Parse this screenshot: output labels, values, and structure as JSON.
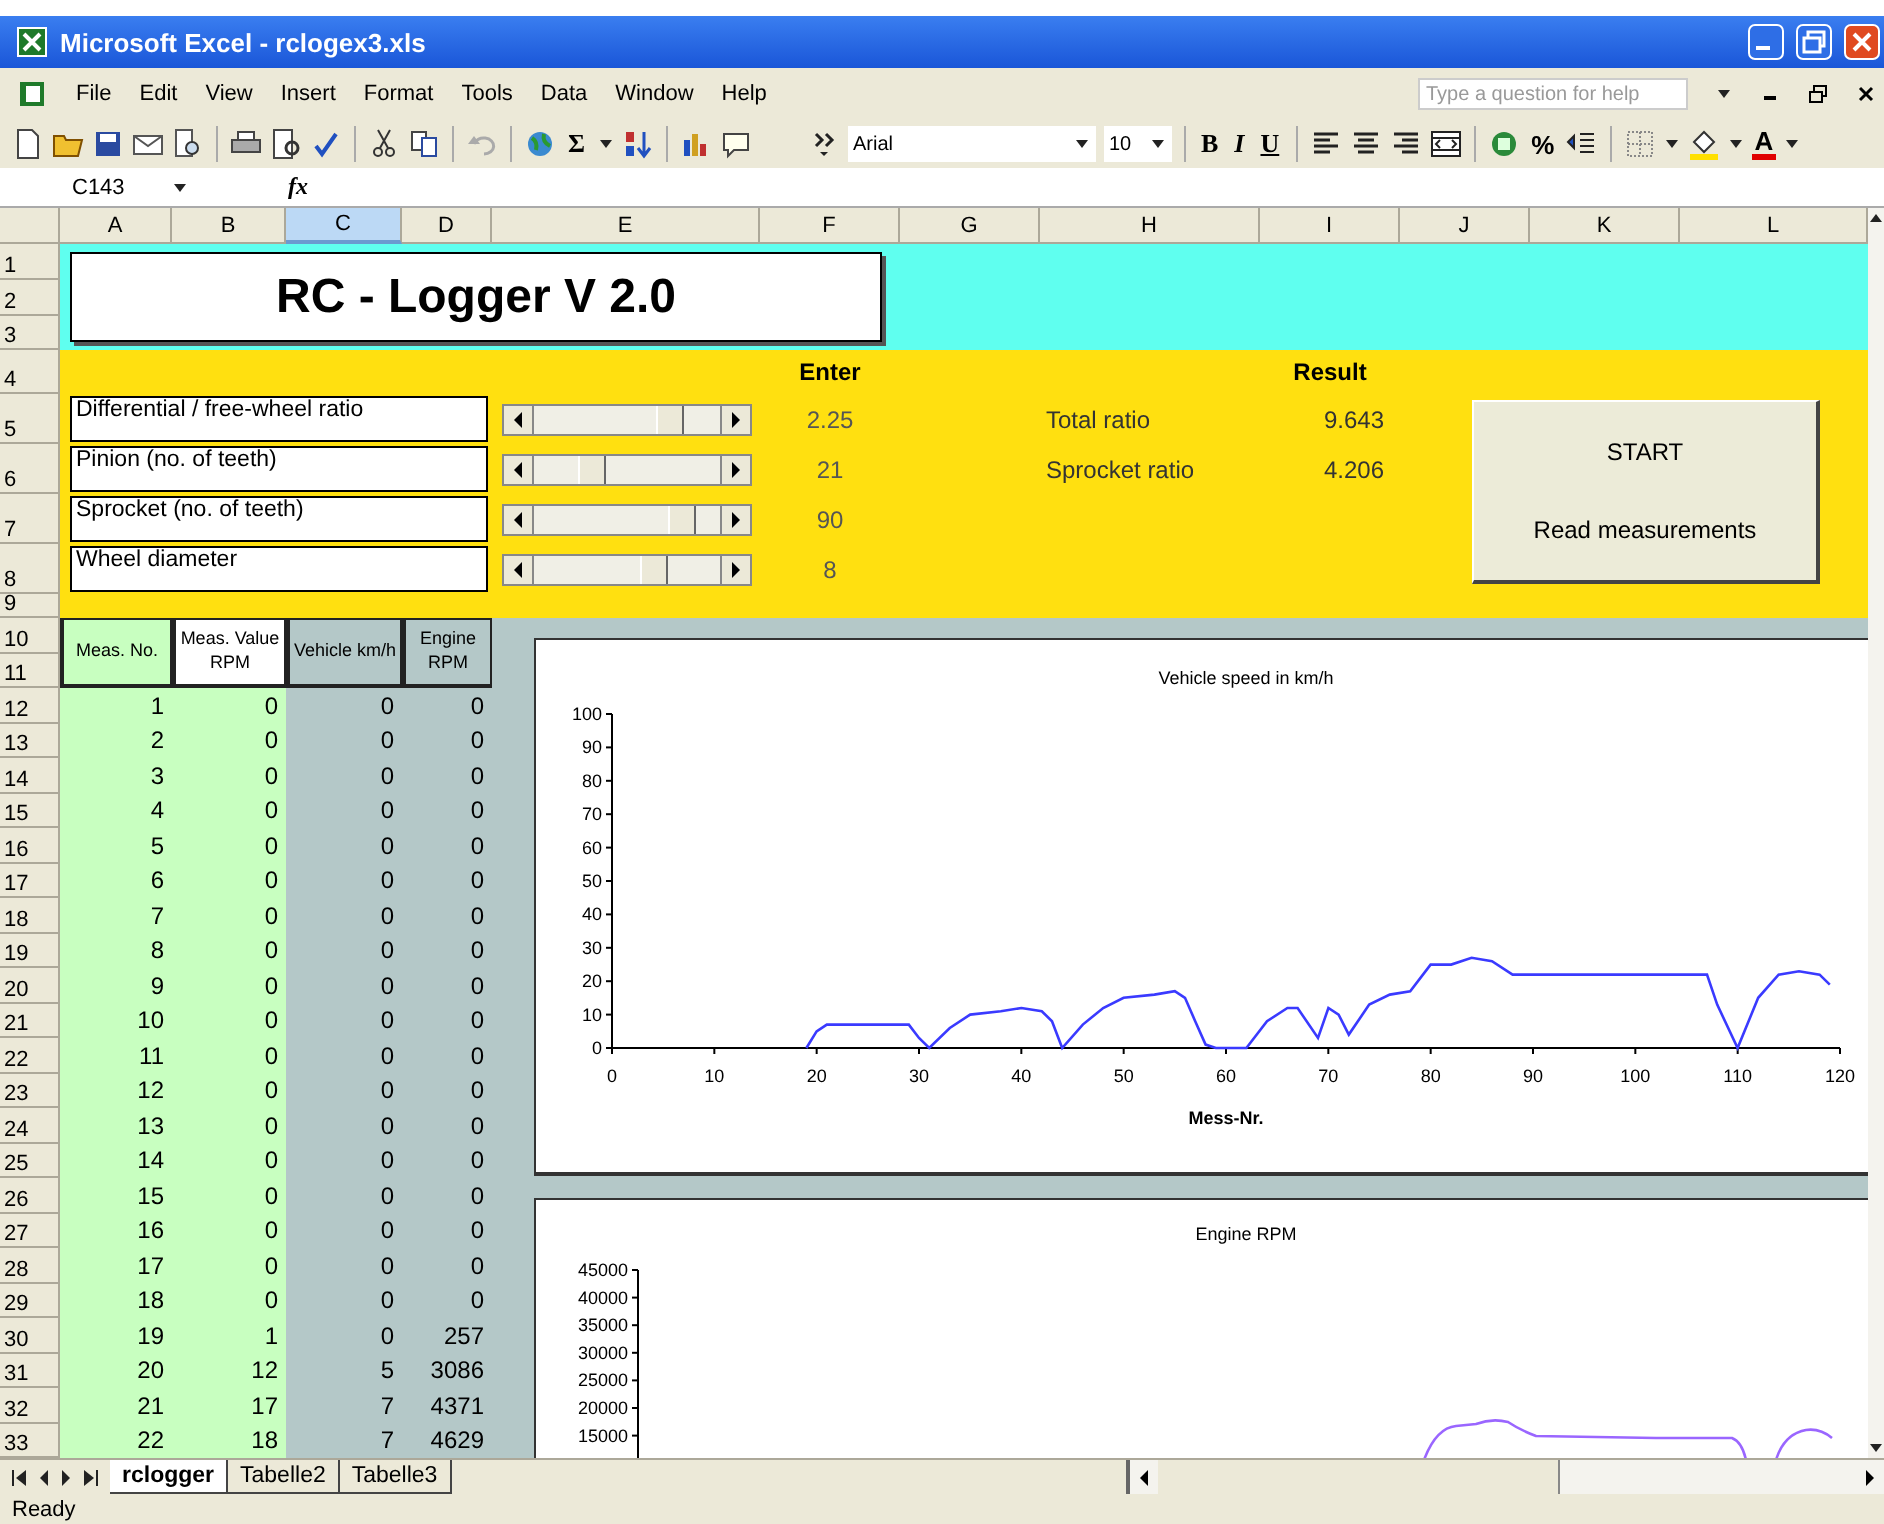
{
  "window": {
    "title": "Microsoft Excel - rclogex3.xls"
  },
  "menu": [
    "File",
    "Edit",
    "View",
    "Insert",
    "Format",
    "Tools",
    "Data",
    "Window",
    "Help"
  ],
  "help_box": {
    "placeholder": "Type a question for help"
  },
  "toolbar": {
    "sum": "Σ",
    "font": "Arial",
    "size": "10",
    "bold": "B",
    "italic": "I",
    "underline": "U",
    "percent": "%",
    "font_color": "A"
  },
  "formula_bar": {
    "name_box": "C143",
    "fx": "fx"
  },
  "columns": [
    {
      "label": "A",
      "selected": false
    },
    {
      "label": "B",
      "selected": false
    },
    {
      "label": "C",
      "selected": true
    },
    {
      "label": "D",
      "selected": false
    },
    {
      "label": "E",
      "selected": false
    },
    {
      "label": "F",
      "selected": false
    },
    {
      "label": "G",
      "selected": false
    },
    {
      "label": "H",
      "selected": false
    },
    {
      "label": "I",
      "selected": false
    },
    {
      "label": "J",
      "selected": false
    },
    {
      "label": "K",
      "selected": false
    },
    {
      "label": "L",
      "selected": false
    }
  ],
  "row_headers": [
    "1",
    "2",
    "3",
    "4",
    "5",
    "6",
    "7",
    "8",
    "9",
    "10",
    "11",
    "12",
    "13",
    "14",
    "15",
    "16",
    "17",
    "18",
    "19",
    "20",
    "21",
    "22",
    "23",
    "24",
    "25",
    "26",
    "27",
    "28",
    "29",
    "30",
    "31",
    "32",
    "33"
  ],
  "banner": {
    "title": "RC - Logger V 2.0"
  },
  "inputs": {
    "enter_header": "Enter",
    "result_header": "Result",
    "params": [
      {
        "label": "Differential / free-wheel ratio",
        "level": 0.72,
        "value": "2.25"
      },
      {
        "label": "Pinion (no. of teeth)",
        "level": 0.3,
        "value": "21"
      },
      {
        "label": "Sprocket (no. of teeth)",
        "level": 0.78,
        "value": "90"
      },
      {
        "label": "Wheel diameter",
        "level": 0.63,
        "value": "8"
      }
    ],
    "results": [
      {
        "label": "Total ratio",
        "value": "9.643"
      },
      {
        "label": "Sprocket ratio",
        "value": "4.206"
      }
    ],
    "button": {
      "lines": [
        "START",
        "Read measurements"
      ]
    }
  },
  "table": {
    "columns": [
      "Meas. No.",
      "Meas. Value RPM",
      "Vehicle km/h",
      "Engine RPM"
    ],
    "rows": [
      [
        "1",
        "0",
        "0",
        "0"
      ],
      [
        "2",
        "0",
        "0",
        "0"
      ],
      [
        "3",
        "0",
        "0",
        "0"
      ],
      [
        "4",
        "0",
        "0",
        "0"
      ],
      [
        "5",
        "0",
        "0",
        "0"
      ],
      [
        "6",
        "0",
        "0",
        "0"
      ],
      [
        "7",
        "0",
        "0",
        "0"
      ],
      [
        "8",
        "0",
        "0",
        "0"
      ],
      [
        "9",
        "0",
        "0",
        "0"
      ],
      [
        "10",
        "0",
        "0",
        "0"
      ],
      [
        "11",
        "0",
        "0",
        "0"
      ],
      [
        "12",
        "0",
        "0",
        "0"
      ],
      [
        "13",
        "0",
        "0",
        "0"
      ],
      [
        "14",
        "0",
        "0",
        "0"
      ],
      [
        "15",
        "0",
        "0",
        "0"
      ],
      [
        "16",
        "0",
        "0",
        "0"
      ],
      [
        "17",
        "0",
        "0",
        "0"
      ],
      [
        "18",
        "0",
        "0",
        "0"
      ],
      [
        "19",
        "1",
        "0",
        "257"
      ],
      [
        "20",
        "12",
        "5",
        "3086"
      ],
      [
        "21",
        "17",
        "7",
        "4371"
      ],
      [
        "22",
        "18",
        "7",
        "4629"
      ]
    ]
  },
  "charts": [
    {
      "chart_data": {
        "type": "line",
        "title": "Vehicle speed in km/h",
        "xlabel": "Mess-Nr.",
        "xlim": [
          0,
          120
        ],
        "ylim": [
          0,
          100
        ],
        "xticks": [
          0,
          10,
          20,
          30,
          40,
          50,
          60,
          70,
          80,
          90,
          100,
          110,
          120
        ],
        "yticks": [
          0,
          10,
          20,
          30,
          40,
          50,
          60,
          70,
          80,
          90,
          100
        ],
        "x": [
          19,
          20,
          21,
          25,
          28,
          29,
          30,
          31,
          33,
          35,
          38,
          40,
          42,
          43,
          44,
          46,
          48,
          50,
          53,
          55,
          56,
          57,
          58,
          59,
          62,
          64,
          66,
          67,
          69,
          70,
          71,
          72,
          74,
          76,
          78,
          80,
          82,
          84,
          86,
          88,
          90,
          100,
          107,
          108,
          110,
          112,
          114,
          116,
          118,
          119
        ],
        "series": [
          {
            "color": "#3a3aff",
            "values": [
              0,
              5,
              7,
              7,
              7,
              7,
              3,
              0,
              6,
              10,
              11,
              12,
              11,
              8,
              0,
              7,
              12,
              15,
              16,
              17,
              15,
              8,
              1,
              0,
              0,
              8,
              12,
              12,
              3,
              12,
              10,
              4,
              13,
              16,
              17,
              25,
              25,
              27,
              26,
              22,
              22,
              22,
              22,
              13,
              0,
              15,
              22,
              23,
              22,
              19
            ]
          }
        ]
      }
    },
    {
      "title": "Engine RPM",
      "axis_labels": [
        "45000",
        "40000",
        "35000",
        "30000",
        "25000",
        "20000",
        "15000"
      ]
    }
  ],
  "sheet_tabs": [
    {
      "label": "rclogger",
      "selected": true
    },
    {
      "label": "Tabelle2",
      "selected": false
    },
    {
      "label": "Tabelle3",
      "selected": false
    }
  ],
  "status_bar": {
    "text": "Ready"
  }
}
